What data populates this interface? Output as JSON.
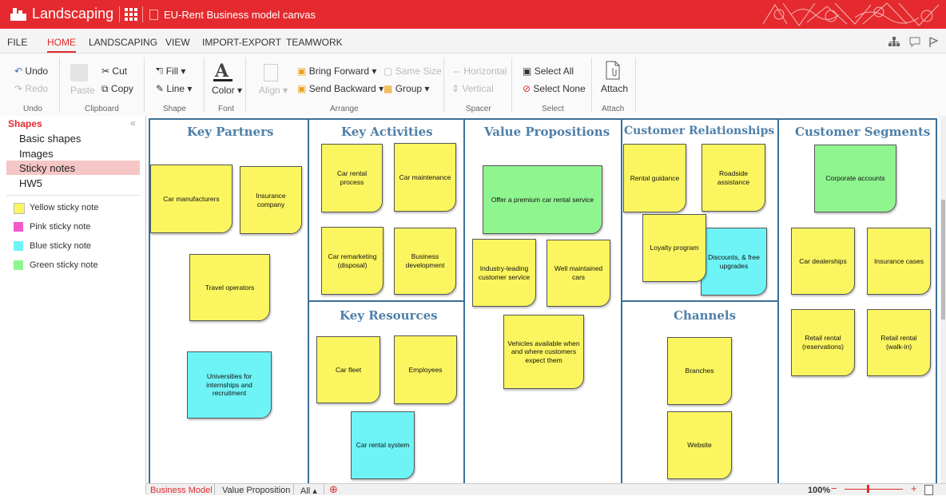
{
  "app": {
    "name": "Landscaping",
    "document_title": "EU-Rent Business model canvas",
    "accent_color": "#e42a2e"
  },
  "menu": [
    "FILE",
    "HOME",
    "LANDSCAPING",
    "VIEW",
    "IMPORT-EXPORT",
    "TEAMWORK"
  ],
  "ribbon": {
    "undo": "Undo",
    "redo": "Redo",
    "paste": "Paste",
    "cut": "Cut",
    "copy": "Copy",
    "fill": "Fill",
    "line": "Line",
    "color": "Color",
    "align": "Align",
    "bring_forward": "Bring Forward",
    "send_backward": "Send Backward",
    "same_size": "Same Size",
    "group": "Group",
    "horizontal": "Horizontal",
    "vertical": "Vertical",
    "select_all": "Select All",
    "select_none": "Select None",
    "attach": "Attach",
    "groups": [
      "Undo",
      "Clipboard",
      "Shape",
      "Font",
      "Arrange",
      "Spacer",
      "Select",
      "Attach"
    ]
  },
  "shapes_panel": {
    "title": "Shapes",
    "categories": [
      "Basic shapes",
      "Images",
      "Sticky notes",
      "HW5"
    ],
    "selected_category": "Sticky notes",
    "items": [
      {
        "label": "Yellow sticky note",
        "color": "#fbf55f"
      },
      {
        "label": "Pink sticky note",
        "color": "#f25ac8"
      },
      {
        "label": "Blue sticky note",
        "color": "#6ef4f6"
      },
      {
        "label": "Green sticky note",
        "color": "#8ff58f"
      }
    ]
  },
  "canvas": {
    "sections": {
      "key_partners": "Key Partners",
      "key_activities": "Key Activities",
      "value_propositions": "Value Propositions",
      "customer_relationships": "Customer Relationships",
      "customer_segments": "Customer Segments",
      "key_resources": "Key Resources",
      "channels": "Channels"
    },
    "notes": {
      "car_manufacturers": "Car manufacturers",
      "insurance_company": "Insurance company",
      "travel_operators": "Travel operators",
      "universities": "Universities for internships and recruitment",
      "car_rental_process": "Car rental process",
      "car_maintenance": "Car maintenance",
      "car_remarketing": "Car remarketing (disposal)",
      "business_development": "Business development",
      "car_fleet": "Car fleet",
      "employees": "Employees",
      "car_rental_system": "Car rental system",
      "premium_car_rental": "Offer a premium car rental service",
      "industry_leading": "Industry-leading customer service",
      "well_maintained": "Well maintained cars",
      "vehicles_available": "Vehicles available when and where customers expect them",
      "rental_guidance": "Rental guidance",
      "roadside_assistance": "Roadside assistance",
      "loyalty_program": "Loyalty program",
      "discounts": "Discounts, & free upgrades",
      "branches": "Branches",
      "website": "Website",
      "corporate_accounts": "Corporate accounts",
      "car_dealerships": "Car dealerships",
      "insurance_cases": "Insurance cases",
      "retail_reservations": "Retail rental (reservations)",
      "retail_walkin": "Retail rental (walk-in)"
    }
  },
  "bottom": {
    "tabs": [
      "Business Model",
      "Value Proposition",
      "All"
    ],
    "active_tab": "Business Model",
    "zoom": "100%"
  }
}
